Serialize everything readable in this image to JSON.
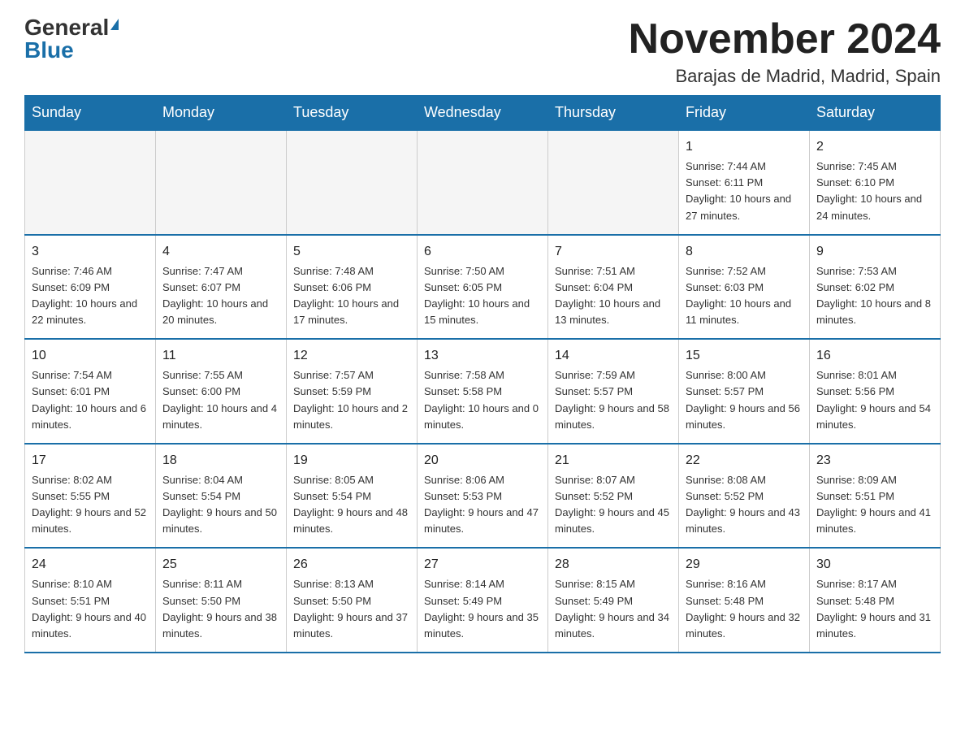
{
  "logo": {
    "general": "General",
    "blue": "Blue"
  },
  "header": {
    "month": "November 2024",
    "location": "Barajas de Madrid, Madrid, Spain"
  },
  "weekdays": [
    "Sunday",
    "Monday",
    "Tuesday",
    "Wednesday",
    "Thursday",
    "Friday",
    "Saturday"
  ],
  "rows": [
    [
      {
        "day": "",
        "info": ""
      },
      {
        "day": "",
        "info": ""
      },
      {
        "day": "",
        "info": ""
      },
      {
        "day": "",
        "info": ""
      },
      {
        "day": "",
        "info": ""
      },
      {
        "day": "1",
        "info": "Sunrise: 7:44 AM\nSunset: 6:11 PM\nDaylight: 10 hours and 27 minutes."
      },
      {
        "day": "2",
        "info": "Sunrise: 7:45 AM\nSunset: 6:10 PM\nDaylight: 10 hours and 24 minutes."
      }
    ],
    [
      {
        "day": "3",
        "info": "Sunrise: 7:46 AM\nSunset: 6:09 PM\nDaylight: 10 hours and 22 minutes."
      },
      {
        "day": "4",
        "info": "Sunrise: 7:47 AM\nSunset: 6:07 PM\nDaylight: 10 hours and 20 minutes."
      },
      {
        "day": "5",
        "info": "Sunrise: 7:48 AM\nSunset: 6:06 PM\nDaylight: 10 hours and 17 minutes."
      },
      {
        "day": "6",
        "info": "Sunrise: 7:50 AM\nSunset: 6:05 PM\nDaylight: 10 hours and 15 minutes."
      },
      {
        "day": "7",
        "info": "Sunrise: 7:51 AM\nSunset: 6:04 PM\nDaylight: 10 hours and 13 minutes."
      },
      {
        "day": "8",
        "info": "Sunrise: 7:52 AM\nSunset: 6:03 PM\nDaylight: 10 hours and 11 minutes."
      },
      {
        "day": "9",
        "info": "Sunrise: 7:53 AM\nSunset: 6:02 PM\nDaylight: 10 hours and 8 minutes."
      }
    ],
    [
      {
        "day": "10",
        "info": "Sunrise: 7:54 AM\nSunset: 6:01 PM\nDaylight: 10 hours and 6 minutes."
      },
      {
        "day": "11",
        "info": "Sunrise: 7:55 AM\nSunset: 6:00 PM\nDaylight: 10 hours and 4 minutes."
      },
      {
        "day": "12",
        "info": "Sunrise: 7:57 AM\nSunset: 5:59 PM\nDaylight: 10 hours and 2 minutes."
      },
      {
        "day": "13",
        "info": "Sunrise: 7:58 AM\nSunset: 5:58 PM\nDaylight: 10 hours and 0 minutes."
      },
      {
        "day": "14",
        "info": "Sunrise: 7:59 AM\nSunset: 5:57 PM\nDaylight: 9 hours and 58 minutes."
      },
      {
        "day": "15",
        "info": "Sunrise: 8:00 AM\nSunset: 5:57 PM\nDaylight: 9 hours and 56 minutes."
      },
      {
        "day": "16",
        "info": "Sunrise: 8:01 AM\nSunset: 5:56 PM\nDaylight: 9 hours and 54 minutes."
      }
    ],
    [
      {
        "day": "17",
        "info": "Sunrise: 8:02 AM\nSunset: 5:55 PM\nDaylight: 9 hours and 52 minutes."
      },
      {
        "day": "18",
        "info": "Sunrise: 8:04 AM\nSunset: 5:54 PM\nDaylight: 9 hours and 50 minutes."
      },
      {
        "day": "19",
        "info": "Sunrise: 8:05 AM\nSunset: 5:54 PM\nDaylight: 9 hours and 48 minutes."
      },
      {
        "day": "20",
        "info": "Sunrise: 8:06 AM\nSunset: 5:53 PM\nDaylight: 9 hours and 47 minutes."
      },
      {
        "day": "21",
        "info": "Sunrise: 8:07 AM\nSunset: 5:52 PM\nDaylight: 9 hours and 45 minutes."
      },
      {
        "day": "22",
        "info": "Sunrise: 8:08 AM\nSunset: 5:52 PM\nDaylight: 9 hours and 43 minutes."
      },
      {
        "day": "23",
        "info": "Sunrise: 8:09 AM\nSunset: 5:51 PM\nDaylight: 9 hours and 41 minutes."
      }
    ],
    [
      {
        "day": "24",
        "info": "Sunrise: 8:10 AM\nSunset: 5:51 PM\nDaylight: 9 hours and 40 minutes."
      },
      {
        "day": "25",
        "info": "Sunrise: 8:11 AM\nSunset: 5:50 PM\nDaylight: 9 hours and 38 minutes."
      },
      {
        "day": "26",
        "info": "Sunrise: 8:13 AM\nSunset: 5:50 PM\nDaylight: 9 hours and 37 minutes."
      },
      {
        "day": "27",
        "info": "Sunrise: 8:14 AM\nSunset: 5:49 PM\nDaylight: 9 hours and 35 minutes."
      },
      {
        "day": "28",
        "info": "Sunrise: 8:15 AM\nSunset: 5:49 PM\nDaylight: 9 hours and 34 minutes."
      },
      {
        "day": "29",
        "info": "Sunrise: 8:16 AM\nSunset: 5:48 PM\nDaylight: 9 hours and 32 minutes."
      },
      {
        "day": "30",
        "info": "Sunrise: 8:17 AM\nSunset: 5:48 PM\nDaylight: 9 hours and 31 minutes."
      }
    ]
  ]
}
